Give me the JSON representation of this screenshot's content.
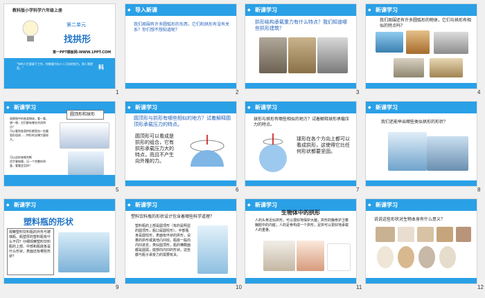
{
  "slides": [
    {
      "num": "1",
      "top_text": "教科版小学科学六年级上册",
      "unit": "第二单元",
      "title": "找拱形",
      "site": "第一PPT模板网-WWW.1PPT.COM",
      "quote": "\"你的人生要留下工作，你都要付出十二万倍的努力。我人我就是。\"",
      "tag": "科"
    },
    {
      "num": "2",
      "header": "导入新课",
      "text": "我们周围有许多圆弧形的东西，它们和拱形有没有关系？你们想不想知道呢？"
    },
    {
      "num": "3",
      "header": "新课学习",
      "text": "拱形结构承载重力有什么特点？我们知道哪些拱形建筑？"
    },
    {
      "num": "4",
      "header": "新课学习",
      "text": "我们周围还有许多圆弧形的物体，它们与拱形有相似的特点吗？"
    },
    {
      "num": "5",
      "header": "新课学习",
      "box_label": "圆顶形和球形",
      "text": "观察图中的各类物体，看一看，想一想，它们都有哪些共同特点？\n可以看到各类拱形都是由一些圆弧形组成……拱形的支撑力量较大。",
      "text2": "可以这样来做判断\n用手掌按摩，压一个完整的鸡蛋，看看会怎样？"
    },
    {
      "num": "6",
      "header": "新课学习",
      "text": "圆顶形与拱形有哪些相似的地方？试着解释圆顶形承载压力的特点。",
      "text2": "圆顶形可以看成是拱形的组合，它有拱形承载压力大的特点，而且不产生向外推的力。"
    },
    {
      "num": "7",
      "header": "新课学习",
      "text": "球形与拱形有哪些相似的地方？试着解释球形承载压力的特点。",
      "text2": "球形在各个方向上都可以看成拱形，这使得它比任何形状都要坚固。"
    },
    {
      "num": "8",
      "header": "新课学习",
      "text": "我们还能举出哪些类似拱形的形状？"
    },
    {
      "num": "9",
      "header": "新课学习",
      "title": "塑料瓶的形状",
      "text": "观察塑料饮料瓶的外形与玻璃瓶、瓶壁厚的塑料瓶有什么不同？仔细观察塑料饮料瓶的上部、中部和瓶底各是什么形状，表面还有哪些形状？"
    },
    {
      "num": "10",
      "header": "新课学习",
      "text": "塑料饮料瓶的形状设计包含着哪些科学道理？",
      "text2": "塑料瓶的上部是圆顶形（有的是明显的圆顶形，瓶口是圆柱形）。中部瓶身是圆柱形，表面有环状的拱形，设着的拱形或其他凸凹纹。瓶底一般向内凹进去，类似圆顶形，瓶的横截面都是圆弧，底部向内凹的形状。这些都与瓶子承受力的需要有关。"
    },
    {
      "num": "11",
      "header": "新课学习",
      "title": "生物体中的拱形",
      "text": "人的头骨近似拱形，可以很好地保护大脑，拱形的胸骨护卫着胸腔中的内脏；人的足骨构成一个拱形，足拱可以更好地承载人的重量。"
    },
    {
      "num": "12",
      "header": "新课学习",
      "text": "说说这些形状对生物本身有什么意义？"
    }
  ],
  "colors": {
    "header": "#2aa0e6",
    "title": "#1f74c7"
  }
}
